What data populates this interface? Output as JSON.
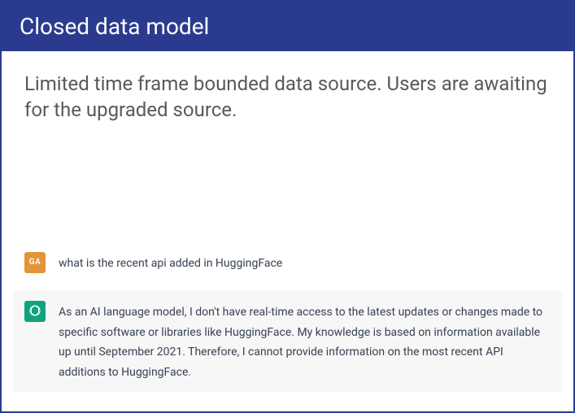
{
  "header": {
    "title": "Closed data model"
  },
  "intro": {
    "text": "Limited time frame bounded data source.  Users are awaiting for the upgraded source."
  },
  "chat": {
    "user": {
      "initials": "GA",
      "message": "what is the recent api added in HuggingFace"
    },
    "assistant": {
      "message": "As an AI language model, I don't have real-time access to the latest updates or changes made to specific software or libraries like HuggingFace. My knowledge is based on information available up until September 2021. Therefore, I cannot provide information on the most recent API additions to HuggingFace."
    }
  }
}
